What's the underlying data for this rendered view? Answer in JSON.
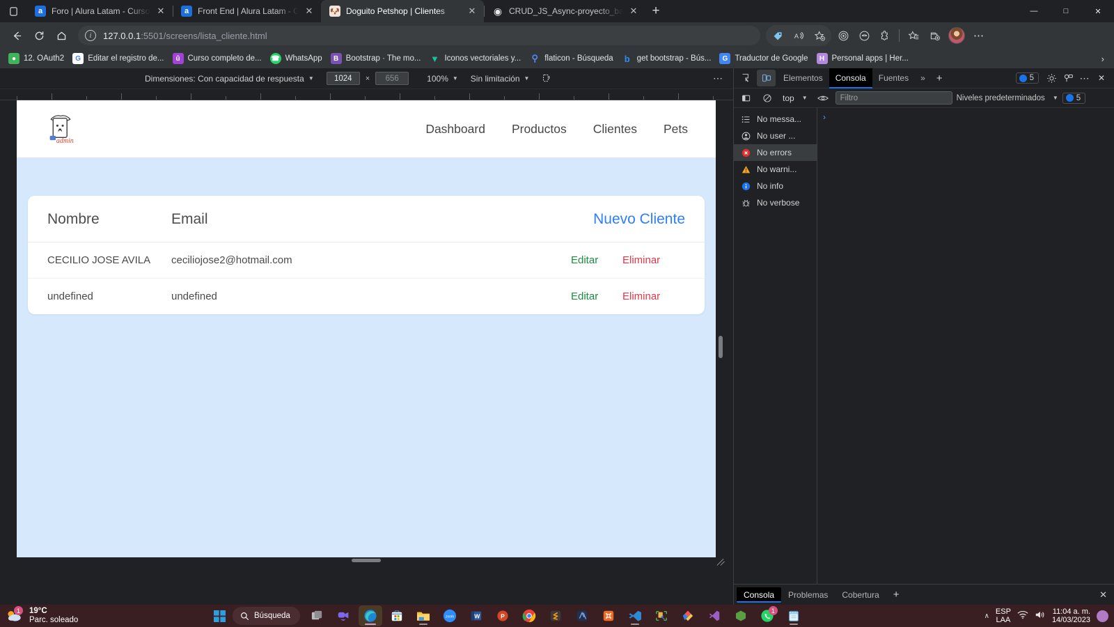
{
  "browser": {
    "tabs": [
      {
        "title": "Foro | Alura Latam - Cursos onlin",
        "favicon": "alura-icon",
        "active": false
      },
      {
        "title": "Front End | Alura Latam - Cursos",
        "favicon": "alura-icon",
        "active": false
      },
      {
        "title": "Doguito Petshop | Clientes",
        "favicon": "doguito-icon",
        "active": true
      },
      {
        "title": "CRUD_JS_Async-proyecto_base/R",
        "favicon": "github-icon",
        "active": false
      }
    ],
    "new_tab_label": "+",
    "window_controls": {
      "minimize": "—",
      "maximize": "□",
      "close": "✕"
    },
    "url_host": "127.0.0.1",
    "url_rest": ":5501/screens/lista_cliente.html",
    "bookmarks": [
      {
        "label": "12. OAuth2",
        "icon_color": "#34a853",
        "icon_char": "●"
      },
      {
        "label": "Editar el registro de...",
        "icon_color": "#ffffff",
        "icon_char": "G"
      },
      {
        "label": "Curso completo de...",
        "icon_color": "#a143d6",
        "icon_char": "û"
      },
      {
        "label": "WhatsApp",
        "icon_color": "#25d366",
        "icon_char": "✆"
      },
      {
        "label": "Bootstrap · The mo...",
        "icon_color": "#7952b3",
        "icon_char": "B"
      },
      {
        "label": "Iconos vectoriales y...",
        "icon_color": "#19c29a",
        "icon_char": "▽"
      },
      {
        "label": "flaticon - Búsqueda",
        "icon_color": "#4d8bf5",
        "icon_char": "⌕"
      },
      {
        "label": "get bootstrap - Bús...",
        "icon_color": "#2c8ef5",
        "icon_char": "b"
      },
      {
        "label": "Traductor de Google",
        "icon_color": "#4285f4",
        "icon_char": "G"
      },
      {
        "label": "Personal apps | Her...",
        "icon_color": "#b488e0",
        "icon_char": "H"
      }
    ],
    "bookmarks_overflow": "›"
  },
  "device_toolbar": {
    "dimensions_label": "Dimensiones: Con capacidad de respuesta",
    "width_value": "1024",
    "height_value": "656",
    "x_separator": "×",
    "zoom_value": "100%",
    "throttling_value": "Sin limitación",
    "more_options": "⋯"
  },
  "page": {
    "logo_text": "admin",
    "nav": [
      {
        "label": "Dashboard"
      },
      {
        "label": "Productos"
      },
      {
        "label": "Clientes"
      },
      {
        "label": "Pets"
      }
    ],
    "table": {
      "headers": {
        "nombre": "Nombre",
        "email": "Email"
      },
      "new_client_label": "Nuevo Cliente",
      "rows": [
        {
          "nombre": "CECILIO JOSE AVILA",
          "email": "ceciliojose2@hotmail.com",
          "edit": "Editar",
          "delete": "Eliminar"
        },
        {
          "nombre": "undefined",
          "email": "undefined",
          "edit": "Editar",
          "delete": "Eliminar"
        }
      ]
    },
    "colors": {
      "page_bg": "#d6e8fb",
      "link_blue": "#2d7ff9",
      "edit_green": "#1e8a3f",
      "delete_red": "#e0374a"
    }
  },
  "devtools": {
    "tabs": [
      {
        "label": "Elementos",
        "active": false
      },
      {
        "label": "Consola",
        "active": true
      },
      {
        "label": "Fuentes",
        "active": false
      }
    ],
    "more_tabs": "»",
    "add_tab": "+",
    "issues_count": "5",
    "filter_bar": {
      "context_value": "top",
      "filter_placeholder": "Filtro",
      "levels_value": "Niveles predeterminados",
      "count": "5"
    },
    "sidebar": [
      {
        "label": "No messa...",
        "icon": "list-icon",
        "selected": false
      },
      {
        "label": "No user ...",
        "icon": "user-icon",
        "selected": false
      },
      {
        "label": "No errors",
        "icon": "error-icon",
        "selected": true
      },
      {
        "label": "No warni...",
        "icon": "warning-icon",
        "selected": false
      },
      {
        "label": "No info",
        "icon": "info-icon",
        "selected": false
      },
      {
        "label": "No verbose",
        "icon": "bug-icon",
        "selected": false
      }
    ],
    "prompt": "›",
    "drawer_tabs": [
      {
        "label": "Consola",
        "active": true
      },
      {
        "label": "Problemas",
        "active": false
      },
      {
        "label": "Cobertura",
        "active": false
      }
    ],
    "drawer_add": "+",
    "drawer_close": "✕"
  },
  "taskbar": {
    "weather_temp": "19°C",
    "weather_desc": "Parc. soleado",
    "weather_badge": "1",
    "search_label": "Búsqueda",
    "apps": [
      {
        "name": "task-view",
        "char": "◰",
        "color": "#9aa0a6",
        "active": false
      },
      {
        "name": "teams",
        "char": "▶",
        "color": "#6264a7",
        "active": false
      },
      {
        "name": "microsoft-edge",
        "char": "e",
        "color": "#2d88d8",
        "active": true
      },
      {
        "name": "microsoft-store",
        "char": "▣",
        "color": "#ffffff",
        "active": false
      },
      {
        "name": "file-explorer",
        "char": "▬",
        "color": "#f7c14b",
        "active": false
      },
      {
        "name": "zoom",
        "char": "zoom",
        "color": "#2d8cff",
        "active": false
      },
      {
        "name": "word",
        "char": "W",
        "color": "#2b579a",
        "active": false
      },
      {
        "name": "powerpoint",
        "char": "P",
        "color": "#d24726",
        "active": false
      },
      {
        "name": "google-chrome",
        "char": "●",
        "color": "#f4b400",
        "active": false
      },
      {
        "name": "sublime-text",
        "char": "S",
        "color": "#3e3e3e",
        "active": false
      },
      {
        "name": "adobe-illustrator",
        "char": "Ai",
        "color": "#2a3a5c",
        "active": false
      },
      {
        "name": "xampp",
        "char": "✖",
        "color": "#f06a24",
        "active": false
      },
      {
        "name": "vs-code",
        "char": "⬡",
        "color": "#1e7fd4",
        "active": false
      },
      {
        "name": "postman-sql",
        "char": "⚒",
        "color": "#e8a33d",
        "active": false
      },
      {
        "name": "adobe-xd",
        "char": "◆",
        "color": "#e44d7b",
        "active": false
      },
      {
        "name": "visual-studio",
        "char": "✦",
        "color": "#9b5ec4",
        "active": false
      },
      {
        "name": "node-js",
        "char": "⬢",
        "color": "#57a143",
        "active": false
      },
      {
        "name": "whatsapp",
        "char": "✆",
        "color": "#25d366",
        "active": false,
        "badge": "1"
      },
      {
        "name": "notepad",
        "char": "☰",
        "color": "#4fb3e8",
        "active": false
      }
    ],
    "lang_line1": "ESP",
    "lang_line2": "LAA",
    "time": "11:04 a. m.",
    "date": "14/03/2023",
    "tray_chevron": "∧"
  }
}
